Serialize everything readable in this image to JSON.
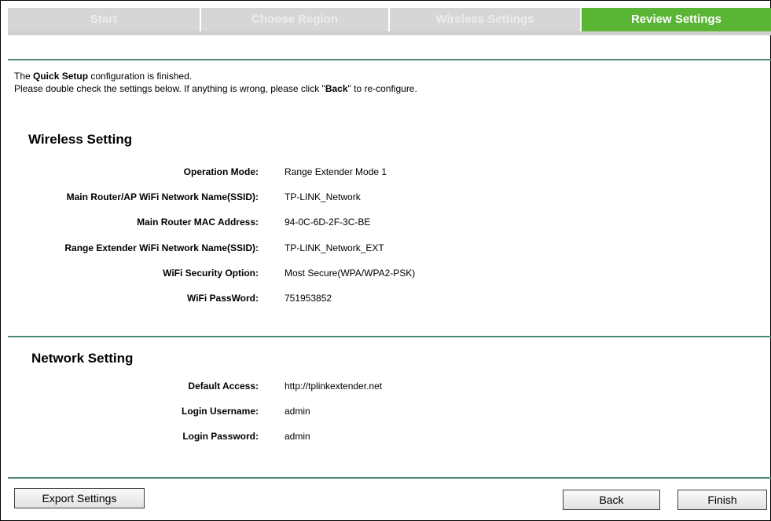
{
  "tabs": [
    {
      "label": "Start",
      "active": false
    },
    {
      "label": "Choose Region",
      "active": false
    },
    {
      "label": "Wireless Settings",
      "active": false
    },
    {
      "label": "Review Settings",
      "active": true
    }
  ],
  "intro": {
    "line1_prefix": "The ",
    "line1_bold": "Quick Setup",
    "line1_suffix": " configuration is finished.",
    "line2_prefix": "Please double check the settings below. If anything is wrong, please click \"",
    "line2_bold": "Back",
    "line2_suffix": "\" to re-configure."
  },
  "wireless": {
    "title": "Wireless Setting",
    "rows": [
      {
        "label": "Operation Mode:",
        "value": "Range Extender Mode 1"
      },
      {
        "label": "Main Router/AP WiFi Network Name(SSID):",
        "value": "TP-LINK_Network"
      },
      {
        "label": "Main Router MAC Address:",
        "value": "94-0C-6D-2F-3C-BE"
      },
      {
        "label": "Range Extender WiFi Network Name(SSID):",
        "value": "TP-LINK_Network_EXT"
      },
      {
        "label": "WiFi Security Option:",
        "value": "Most Secure(WPA/WPA2-PSK)"
      },
      {
        "label": "WiFi PassWord:",
        "value": "751953852"
      }
    ]
  },
  "network": {
    "title": "Network Setting",
    "rows": [
      {
        "label": "Default Access:",
        "value": "http://tplinkextender.net"
      },
      {
        "label": "Login Username:",
        "value": "admin"
      },
      {
        "label": "Login Password:",
        "value": "admin"
      }
    ]
  },
  "buttons": {
    "export": "Export Settings",
    "back": "Back",
    "finish": "Finish"
  },
  "colors": {
    "active_tab": "#5bb534",
    "inactive_tab": "#d6d6d6",
    "divider": "#4a8a6a"
  }
}
